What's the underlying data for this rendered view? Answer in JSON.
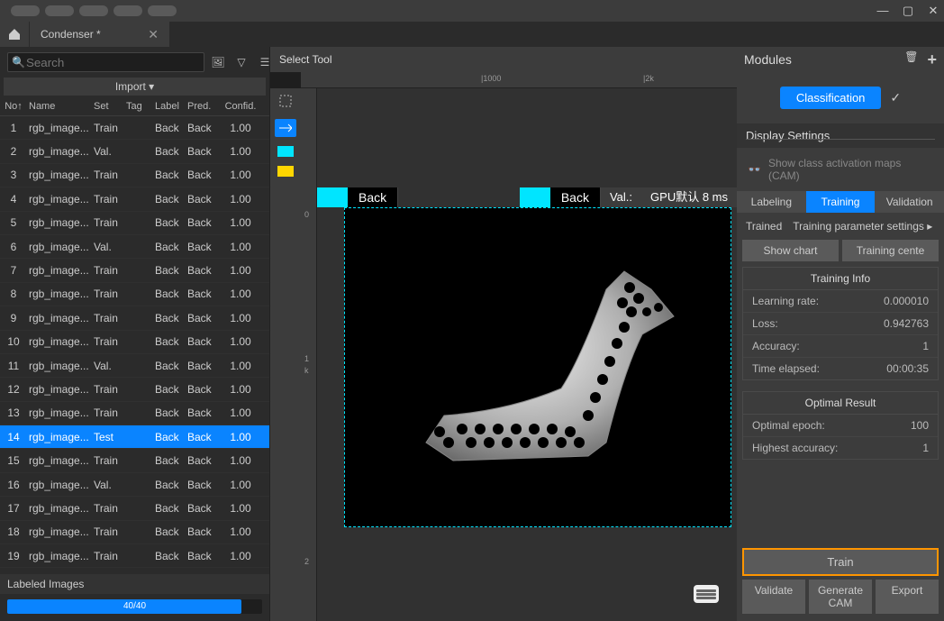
{
  "titlebar": {
    "minimize": "—",
    "maximize": "▢",
    "close": "✕"
  },
  "tab": {
    "title": "Condenser *",
    "close": "✕"
  },
  "search": {
    "placeholder": "Search"
  },
  "import": {
    "label": "Import  ▾"
  },
  "columns": {
    "no": "No↑",
    "name": "Name",
    "set": "Set",
    "tag": "Tag",
    "label": "Label",
    "pred": "Pred.",
    "conf": "Confid."
  },
  "rows": [
    {
      "no": "1",
      "name": "rgb_image...",
      "set": "Train",
      "label": "Back",
      "pred": "Back",
      "conf": "1.00",
      "sel": false
    },
    {
      "no": "2",
      "name": "rgb_image...",
      "set": "Val.",
      "label": "Back",
      "pred": "Back",
      "conf": "1.00",
      "sel": false
    },
    {
      "no": "3",
      "name": "rgb_image...",
      "set": "Train",
      "label": "Back",
      "pred": "Back",
      "conf": "1.00",
      "sel": false
    },
    {
      "no": "4",
      "name": "rgb_image...",
      "set": "Train",
      "label": "Back",
      "pred": "Back",
      "conf": "1.00",
      "sel": false
    },
    {
      "no": "5",
      "name": "rgb_image...",
      "set": "Train",
      "label": "Back",
      "pred": "Back",
      "conf": "1.00",
      "sel": false
    },
    {
      "no": "6",
      "name": "rgb_image...",
      "set": "Val.",
      "label": "Back",
      "pred": "Back",
      "conf": "1.00",
      "sel": false
    },
    {
      "no": "7",
      "name": "rgb_image...",
      "set": "Train",
      "label": "Back",
      "pred": "Back",
      "conf": "1.00",
      "sel": false
    },
    {
      "no": "8",
      "name": "rgb_image...",
      "set": "Train",
      "label": "Back",
      "pred": "Back",
      "conf": "1.00",
      "sel": false
    },
    {
      "no": "9",
      "name": "rgb_image...",
      "set": "Train",
      "label": "Back",
      "pred": "Back",
      "conf": "1.00",
      "sel": false
    },
    {
      "no": "10",
      "name": "rgb_image...",
      "set": "Train",
      "label": "Back",
      "pred": "Back",
      "conf": "1.00",
      "sel": false
    },
    {
      "no": "11",
      "name": "rgb_image...",
      "set": "Val.",
      "label": "Back",
      "pred": "Back",
      "conf": "1.00",
      "sel": false
    },
    {
      "no": "12",
      "name": "rgb_image...",
      "set": "Train",
      "label": "Back",
      "pred": "Back",
      "conf": "1.00",
      "sel": false
    },
    {
      "no": "13",
      "name": "rgb_image...",
      "set": "Train",
      "label": "Back",
      "pred": "Back",
      "conf": "1.00",
      "sel": false
    },
    {
      "no": "14",
      "name": "rgb_image...",
      "set": "Test",
      "label": "Back",
      "pred": "Back",
      "conf": "1.00",
      "sel": true
    },
    {
      "no": "15",
      "name": "rgb_image...",
      "set": "Train",
      "label": "Back",
      "pred": "Back",
      "conf": "1.00",
      "sel": false
    },
    {
      "no": "16",
      "name": "rgb_image...",
      "set": "Val.",
      "label": "Back",
      "pred": "Back",
      "conf": "1.00",
      "sel": false
    },
    {
      "no": "17",
      "name": "rgb_image...",
      "set": "Train",
      "label": "Back",
      "pred": "Back",
      "conf": "1.00",
      "sel": false
    },
    {
      "no": "18",
      "name": "rgb_image...",
      "set": "Train",
      "label": "Back",
      "pred": "Back",
      "conf": "1.00",
      "sel": false
    },
    {
      "no": "19",
      "name": "rgb_image...",
      "set": "Train",
      "label": "Back",
      "pred": "Back",
      "conf": "1.00",
      "sel": false
    }
  ],
  "labeled": {
    "label": "Labeled Images",
    "progress": "40/40"
  },
  "center": {
    "title": "Select Tool",
    "ruler": {
      "r1000": "|1000",
      "r2k": "|2k",
      "v0": "0",
      "v1": "1",
      "v1k": "k",
      "v2": "2"
    },
    "overlay": {
      "back1": "Back",
      "back2": "Back",
      "val": "Val.:",
      "gpu": "GPU默认 8 ms"
    }
  },
  "right": {
    "header": "Modules",
    "module": "Classification",
    "display_settings": "Display Settings",
    "cam": "Show class activation maps (CAM)",
    "tabs": {
      "labeling": "Labeling",
      "training": "Training",
      "validation": "Validation"
    },
    "trained": "Trained",
    "params": "Training parameter settings ▸",
    "show_chart": "Show chart",
    "training_center": "Training cente",
    "training_info": {
      "title": "Training Info",
      "lr": "Learning rate:",
      "lr_v": "0.000010",
      "loss": "Loss:",
      "loss_v": "0.942763",
      "acc": "Accuracy:",
      "acc_v": "1",
      "time": "Time elapsed:",
      "time_v": "00:00:35"
    },
    "optimal": {
      "title": "Optimal Result",
      "epoch": "Optimal epoch:",
      "epoch_v": "100",
      "hacc": "Highest accuracy:",
      "hacc_v": "1"
    },
    "train": "Train",
    "validate": "Validate",
    "gen_cam": "Generate CAM",
    "export": "Export"
  }
}
